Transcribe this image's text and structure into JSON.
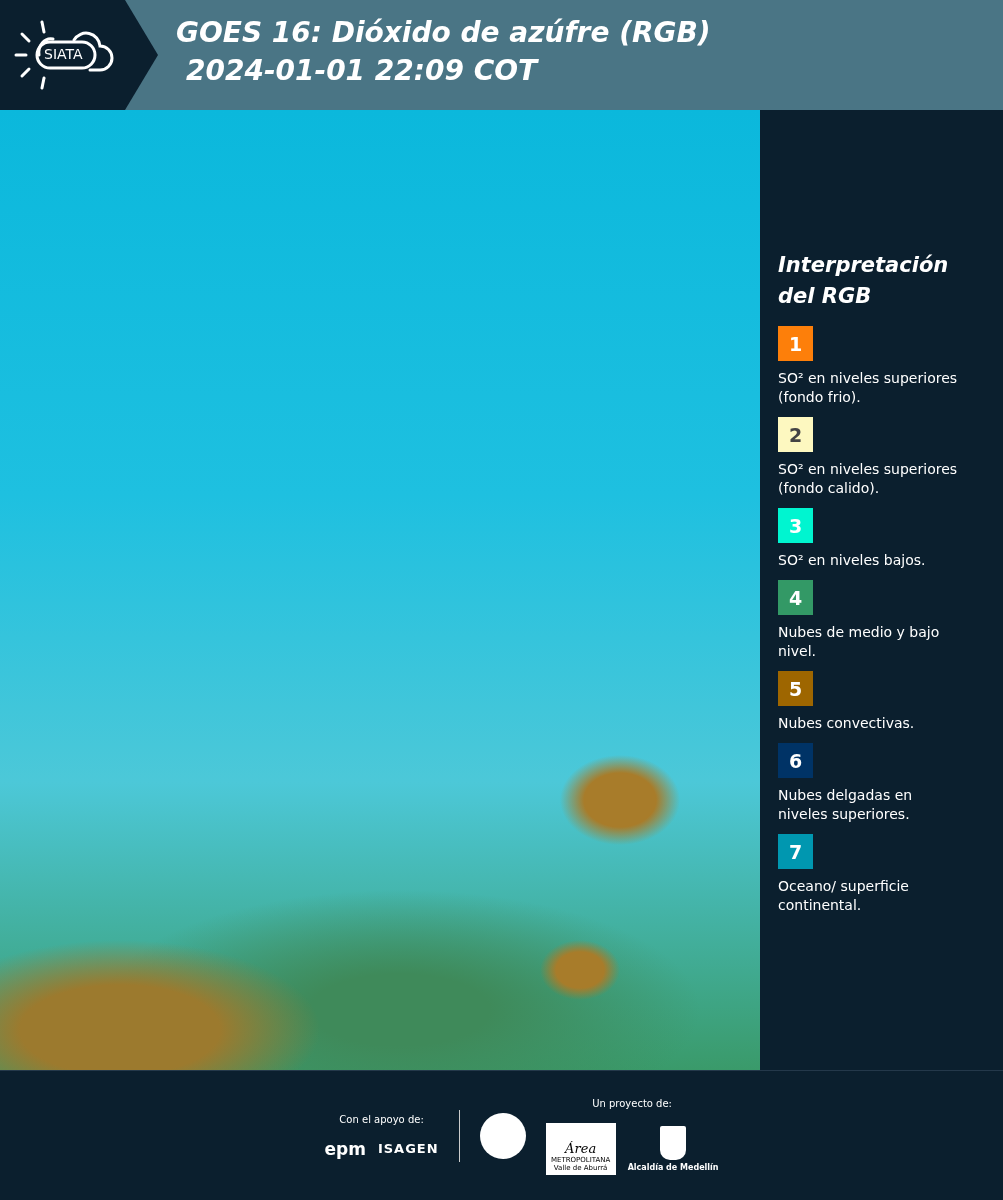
{
  "header": {
    "logo_text": "SIATA",
    "title": "GOES 16: Dióxido de azúfre (RGB)",
    "subtitle": "2024-01-01 22:09 COT"
  },
  "legend": {
    "title": "Interpretación del RGB",
    "items": [
      {
        "number": "1",
        "color": "#fd7f0a",
        "text": "SO² en niveles superiores (fondo frio)."
      },
      {
        "number": "2",
        "color": "#fdf8c0",
        "text": "SO² en niveles superiores (fondo calido)."
      },
      {
        "number": "3",
        "color": "#00f5d0",
        "text": "SO² en niveles bajos."
      },
      {
        "number": "4",
        "color": "#339966",
        "text": "Nubes de medio y bajo nivel."
      },
      {
        "number": "5",
        "color": "#9e6600",
        "text": "Nubes convectivas."
      },
      {
        "number": "6",
        "color": "#003366",
        "text": "Nubes delgadas en niveles superiores."
      },
      {
        "number": "7",
        "color": "#0097b0",
        "text": "Oceano/ superficie continental."
      }
    ]
  },
  "footer": {
    "support_label": "Con el apoyo de:",
    "support_logos": [
      "epm",
      "ISAGEN"
    ],
    "project_label": "Un proyecto de:",
    "area_logo": {
      "name": "Área",
      "line1": "METROPOLITANA",
      "line2": "Valle de Aburrá"
    },
    "alcaldia": "Alcaldía de Medellín"
  }
}
